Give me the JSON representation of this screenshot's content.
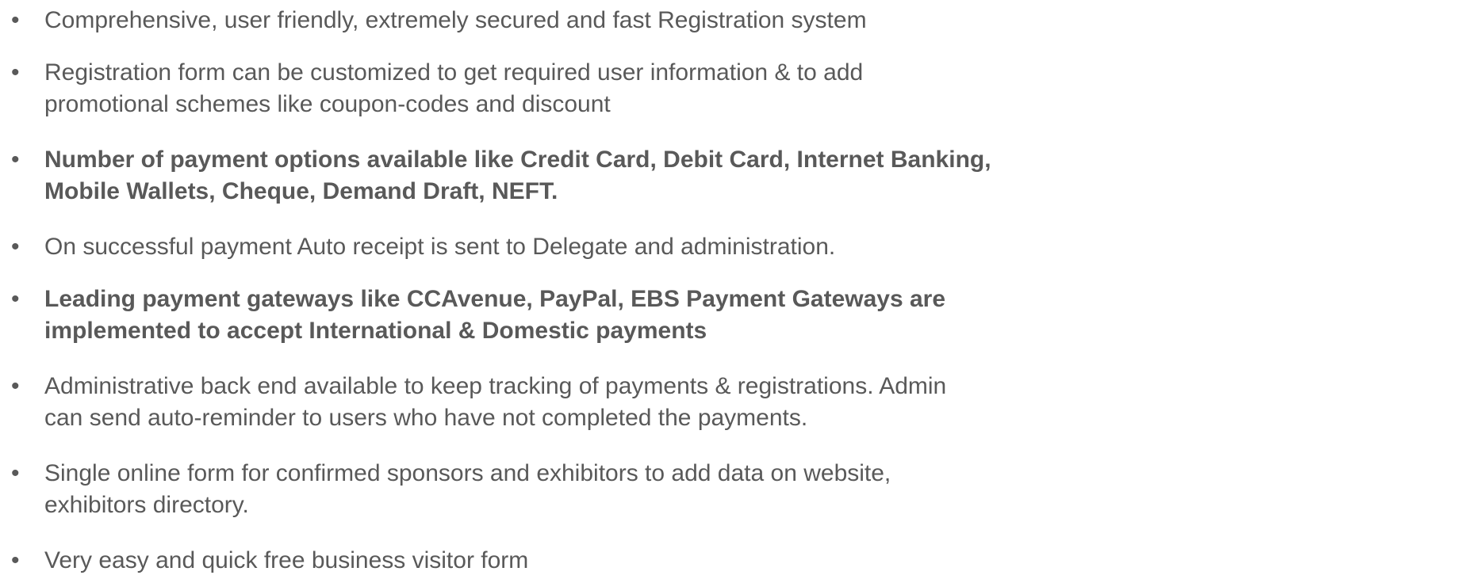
{
  "bullets": [
    {
      "bold": false,
      "lines": [
        "Comprehensive, user friendly, extremely secured and fast Registration system"
      ]
    },
    {
      "bold": false,
      "lines": [
        "Registration form can be customized to get required user information & to add",
        "promotional schemes like coupon-codes and discount"
      ]
    },
    {
      "bold": true,
      "lines": [
        "Number of payment options available like Credit Card, Debit Card, Internet Banking,",
        "Mobile Wallets, Cheque, Demand Draft, NEFT."
      ]
    },
    {
      "bold": false,
      "lines": [
        "On successful payment Auto receipt is sent to Delegate and administration."
      ]
    },
    {
      "bold": true,
      "lines": [
        "Leading payment gateways like CCAvenue, PayPal, EBS Payment Gateways are",
        "implemented to accept International & Domestic payments"
      ]
    },
    {
      "bold": false,
      "lines": [
        "Administrative back end available to keep tracking of payments & registrations. Admin",
        "can send auto-reminder to users who have not completed the payments."
      ]
    },
    {
      "bold": false,
      "lines": [
        "Single online form for confirmed sponsors and exhibitors to add data on website,",
        "exhibitors directory."
      ]
    },
    {
      "bold": false,
      "lines": [
        "Very easy and quick free business visitor form"
      ]
    }
  ],
  "bullet_glyph": "•"
}
